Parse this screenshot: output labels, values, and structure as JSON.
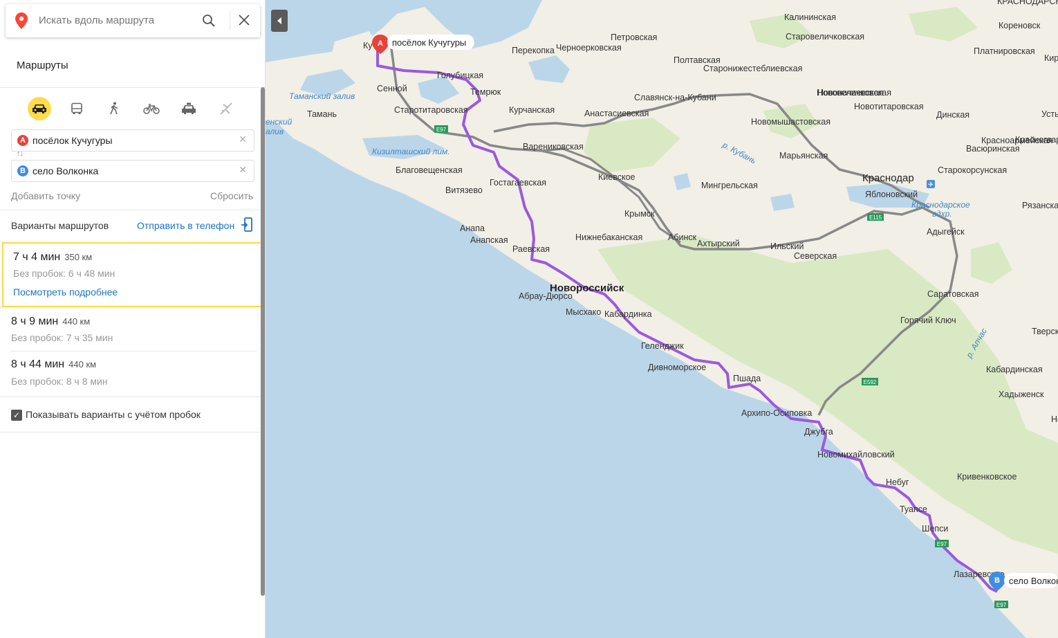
{
  "search": {
    "placeholder": "Искать вдоль маршрута"
  },
  "routes_title": "Маршруты",
  "modes": [
    {
      "name": "car",
      "icon": "car-icon",
      "active": true
    },
    {
      "name": "bus",
      "icon": "bus-icon",
      "active": false
    },
    {
      "name": "walk",
      "icon": "pedestrian-icon",
      "active": false
    },
    {
      "name": "bike",
      "icon": "bicycle-icon",
      "active": false
    },
    {
      "name": "taxi",
      "icon": "taxi-icon",
      "active": false
    },
    {
      "name": "plane",
      "icon": "airplane-icon",
      "active": false
    }
  ],
  "points": {
    "a": {
      "badge": "A",
      "value": "посёлок Кучугуры",
      "color": "#e8423a"
    },
    "b": {
      "badge": "B",
      "value": "село Волконка",
      "color": "#3d8ee0"
    }
  },
  "add_point": "Добавить точку",
  "reset": "Сбросить",
  "variants_title": "Варианты маршрутов",
  "send_to_phone": "Отправить в телефон",
  "routes": [
    {
      "time": "7 ч 4 мин",
      "distance": "350 км",
      "no_traffic": "Без пробок: 6 ч 48 мин",
      "more": "Посмотреть подробнее",
      "selected": true
    },
    {
      "time": "8 ч 9 мин",
      "distance": "440 км",
      "no_traffic": "Без пробок: 7 ч 35 мин",
      "selected": false
    },
    {
      "time": "8 ч 44 мин",
      "distance": "440 км",
      "no_traffic": "Без пробок: 8 ч 8 мин",
      "selected": false
    }
  ],
  "traffic_checkbox": {
    "label": "Показывать варианты с учётом пробок",
    "checked": true
  },
  "map": {
    "colors": {
      "sea": "#bcd6e9",
      "land": "#f2efe6",
      "green": "#d9e9c4",
      "route": "#9b59e0",
      "alt_route": "#888888"
    },
    "start_label": "посёлок Кучугуры",
    "end_label": "село Волконк",
    "start_badge": "A",
    "end_badge": "B",
    "water_labels": [
      "Таманский залив",
      "Кизилташский лим.",
      "р. Кубань",
      "Краснодарское",
      "вдхр.",
      "р. Апчас",
      "енский",
      "алив"
    ],
    "towns": [
      "Ку",
      "Сенной",
      "Голубицкая",
      "Темрюк",
      "Тамань",
      "Старотитаровская",
      "Курчанская",
      "Анастасиевская",
      "Славянск-на-Кубани",
      "Полтавская",
      "Старонижестеблиевская",
      "Петровская",
      "Перекопка",
      "Черноерковская",
      "Калининская",
      "Старовеличковская",
      "Кореновск",
      "Платнировская",
      "Новоначаевская",
      "Вареникoвская",
      "Благовещенская",
      "Витязево",
      "Гостагаевская",
      "Анапа",
      "Анапская",
      "Раевская",
      "Киевское",
      "Крымск",
      "Абинск",
      "Ахтырский",
      "Ильский",
      "Северская",
      "Нижнебаканская",
      "Мингрельская",
      "Новомышастовская",
      "Марьянская",
      "Нововеличковская",
      "Новотитаровская",
      "Динская",
      "Красноармейская",
      "Васюринская",
      "Старокорсунская",
      "Краснодар",
      "Яблоновский",
      "Адыгейск",
      "Рязанская",
      "Новороссийск",
      "Абрау-Дюрсо",
      "Мысхако",
      "Кабардинка",
      "Геленджик",
      "Дивноморское",
      "Пшада",
      "Архипо-Осиповка",
      "Джубга",
      "Новомихайловский",
      "Небуг",
      "Туапсе",
      "Шепси",
      "Лазаревское",
      "Саратовская",
      "Горячий Ключ",
      "Кабардинская",
      "Хадыженск",
      "Кривенковское",
      "Тверская",
      "Усть",
      "Кир",
      "КРАСНОДАРСК",
      "Красногвард",
      "Не"
    ],
    "road_shields": [
      "E97",
      "E115",
      "E592",
      "E97",
      "E97"
    ]
  }
}
